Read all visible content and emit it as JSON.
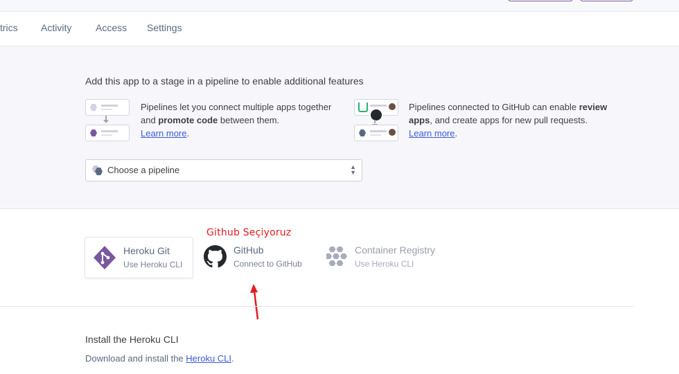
{
  "tabs": [
    "trics",
    "Activity",
    "Access",
    "Settings"
  ],
  "pipeline": {
    "title": "Add this app to a stage in a pipeline to enable additional features",
    "left": {
      "text_pre": "Pipelines let you connect multiple apps together and ",
      "bold": "promote code",
      "text_post": " between them.",
      "link": "Learn more",
      "end": "."
    },
    "right": {
      "text_pre": "Pipelines connected to GitHub can enable ",
      "bold": "review apps",
      "text_post": ", and create apps for new pull requests.",
      "link": "Learn more",
      "end": "."
    },
    "select_value": "Choose a pipeline"
  },
  "deploy_methods": [
    {
      "name": "Heroku Git",
      "sub": "Use Heroku CLI",
      "icon": "heroku-git-icon"
    },
    {
      "name": "GitHub",
      "sub": "Connect to GitHub",
      "icon": "github-icon"
    },
    {
      "name": "Container Registry",
      "sub": "Use Heroku CLI",
      "icon": "container-registry-icon"
    }
  ],
  "annotation": "Github Seçiyoruz",
  "cli": {
    "title": "Install the Heroku CLI",
    "text_pre": "Download and install the ",
    "link": "Heroku CLI",
    "end": "."
  },
  "colors": {
    "accent": "#79589f",
    "link": "#3a5bd9",
    "annotation": "#e21b22"
  }
}
